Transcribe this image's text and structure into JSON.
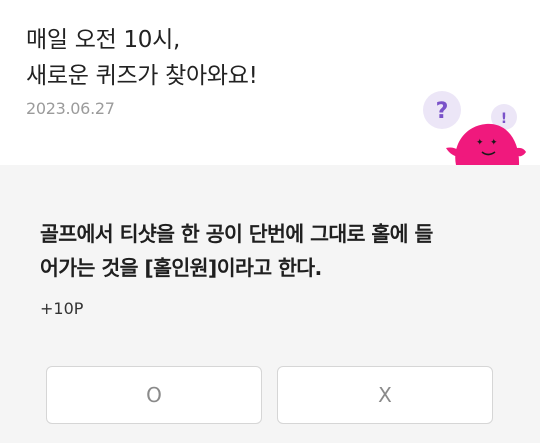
{
  "header": {
    "headline_line1": "매일 오전 10시,",
    "headline_line2": "새로운 퀴즈가 찾아와요!",
    "date": "2023.06.27"
  },
  "mascot": {
    "bubble_icon": "question-mark",
    "bubble_text": "?",
    "exclaim_text": "!",
    "body_color": "#f0197d",
    "bubble_text_color": "#7a52c9"
  },
  "quiz": {
    "question_line1": "골프에서 티샷을 한 공이 단번에 그대로 홀에 들",
    "question_line2": "어가는 것을 [홀인원]이라고 한다.",
    "reward": "+10P",
    "options": [
      "O",
      "X"
    ]
  }
}
